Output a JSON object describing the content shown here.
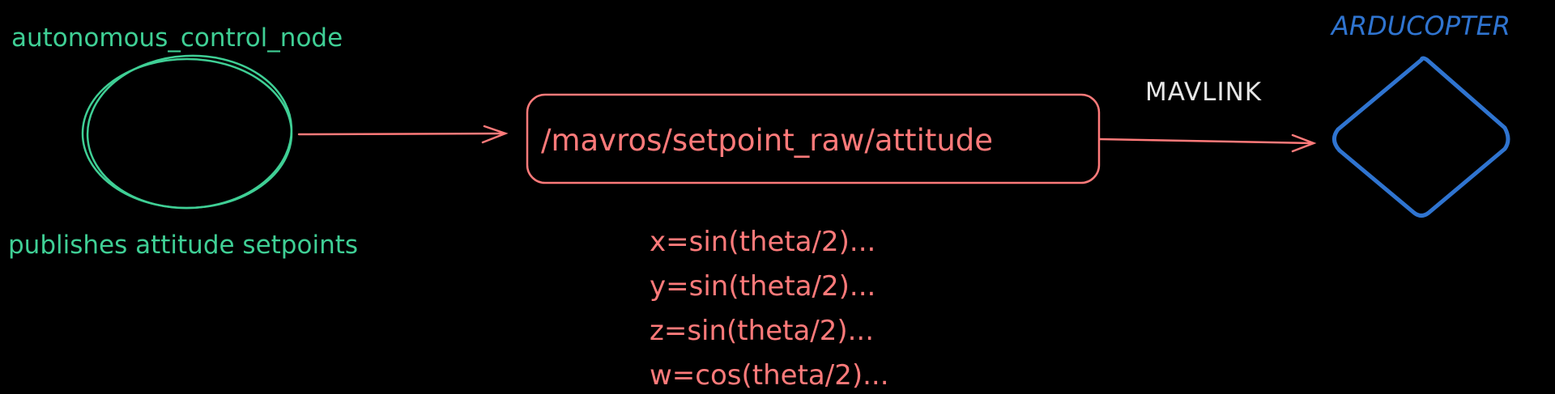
{
  "node": {
    "name": "autonomous_control_node",
    "description": "publishes attitude setpoints"
  },
  "topic": {
    "name": "/mavros/setpoint_raw/attitude"
  },
  "formulas": [
    "x=sin(theta/2)...",
    "y=sin(theta/2)...",
    "z=sin(theta/2)...",
    "w=cos(theta/2)..."
  ],
  "link": {
    "protocol": "MAVLINK"
  },
  "target": {
    "name": "ARDUCOPTER"
  },
  "colors": {
    "node": "#3fcf95",
    "topic": "#ff7a7a",
    "protocol_text": "#e6e6e6",
    "target": "#2f74d0",
    "background": "#000000"
  }
}
